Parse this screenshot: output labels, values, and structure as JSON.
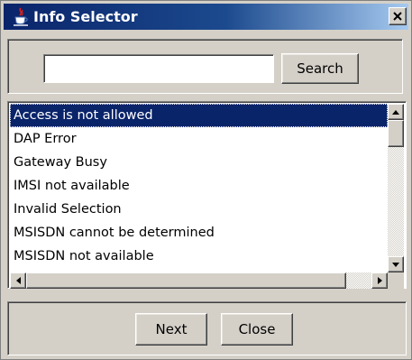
{
  "window": {
    "title": "Info Selector",
    "icon": "java-coffee-icon",
    "close_glyph": "✕"
  },
  "search": {
    "value": "",
    "placeholder": "",
    "button_label": "Search"
  },
  "list": {
    "items": [
      {
        "label": "Access is not allowed",
        "selected": true
      },
      {
        "label": "DAP Error",
        "selected": false
      },
      {
        "label": "Gateway Busy",
        "selected": false
      },
      {
        "label": "IMSI not available",
        "selected": false
      },
      {
        "label": "Invalid Selection",
        "selected": false
      },
      {
        "label": "MSISDN cannot be determined",
        "selected": false
      },
      {
        "label": "MSISDN not available",
        "selected": false
      }
    ]
  },
  "footer": {
    "next_label": "Next",
    "close_label": "Close"
  },
  "colors": {
    "title_bar": "#0a246a",
    "selection": "#0a246a",
    "face": "#d4d0c8"
  }
}
